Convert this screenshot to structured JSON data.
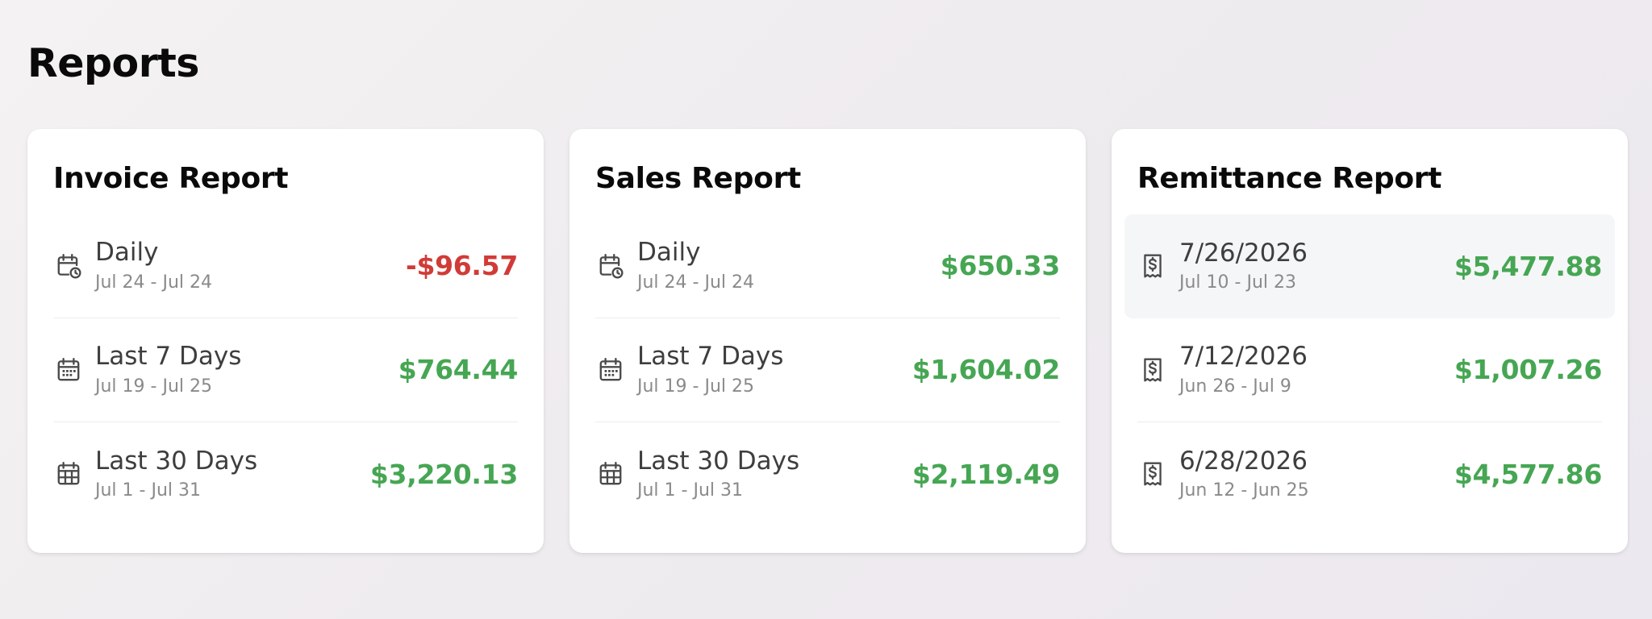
{
  "page": {
    "title": "Reports"
  },
  "colors": {
    "positive": "#46a653",
    "negative": "#d13b37",
    "highlight_row": "#f5f6f8"
  },
  "invoice": {
    "title": "Invoice Report",
    "rows": [
      {
        "label": "Daily",
        "range": "Jul 24 - Jul 24",
        "value": "-$96.57",
        "icon": "calendar-clock-icon",
        "status": "negative"
      },
      {
        "label": "Last 7 Days",
        "range": "Jul 19 - Jul 25",
        "value": "$764.44",
        "icon": "calendar-week-icon",
        "status": "positive"
      },
      {
        "label": "Last 30 Days",
        "range": "Jul 1 - Jul 31",
        "value": "$3,220.13",
        "icon": "calendar-month-icon",
        "status": "positive"
      }
    ]
  },
  "sales": {
    "title": "Sales Report",
    "rows": [
      {
        "label": "Daily",
        "range": "Jul 24 - Jul 24",
        "value": "$650.33",
        "icon": "calendar-clock-icon",
        "status": "positive"
      },
      {
        "label": "Last 7 Days",
        "range": "Jul 19 - Jul 25",
        "value": "$1,604.02",
        "icon": "calendar-week-icon",
        "status": "positive"
      },
      {
        "label": "Last 30 Days",
        "range": "Jul 1 - Jul 31",
        "value": "$2,119.49",
        "icon": "calendar-month-icon",
        "status": "positive"
      }
    ]
  },
  "remittance": {
    "title": "Remittance Report",
    "rows": [
      {
        "label": "7/26/2026",
        "range": "Jul 10 - Jul 23",
        "value": "$5,477.88",
        "icon": "receipt-dollar-icon",
        "status": "positive",
        "highlighted": true
      },
      {
        "label": "7/12/2026",
        "range": "Jun 26 - Jul 9",
        "value": "$1,007.26",
        "icon": "receipt-dollar-icon",
        "status": "positive"
      },
      {
        "label": "6/28/2026",
        "range": "Jun 12 - Jun 25",
        "value": "$4,577.86",
        "icon": "receipt-dollar-icon",
        "status": "positive"
      }
    ]
  }
}
